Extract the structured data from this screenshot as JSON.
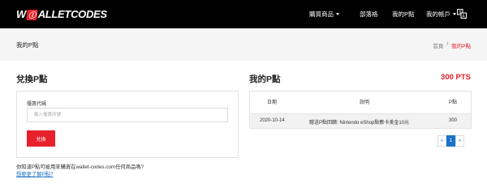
{
  "logo": {
    "prefix": "W",
    "badge": "Ⓛ",
    "text": "ALLETCODES"
  },
  "nav": {
    "items": [
      {
        "label": "購買商品",
        "has_caret": true
      },
      {
        "label": "部落格",
        "has_caret": false
      },
      {
        "label": "我的P點",
        "has_caret": false
      },
      {
        "label": "我的帳戶",
        "has_caret": true
      }
    ],
    "lang_icon": "translate-icon"
  },
  "page": {
    "title": "我的P點",
    "breadcrumb": [
      "首頁",
      "/",
      "我的P點"
    ]
  },
  "redeem": {
    "title": "兌換P點",
    "field_label": "優惠代碼",
    "placeholder": "輸入優惠序號",
    "button": "兌換",
    "note": "你知道P點可被用來購買在wallet-codes.com任何商品嗎?",
    "link": "想要更了解P點?"
  },
  "points": {
    "title": "我的P點",
    "total": "300 PTS",
    "columns": [
      "日期",
      "說明",
      "P點"
    ],
    "rows": [
      {
        "date": "2020-10-14",
        "desc": "贈送P點回饋: Nintendo eShop點數卡美金10元",
        "pts": "300"
      }
    ]
  },
  "pagination": {
    "prev": "«",
    "current": "1",
    "next": "»"
  },
  "colors": {
    "accent": "#e8202a",
    "link": "#1a73c8",
    "header_bg": "#000000"
  }
}
